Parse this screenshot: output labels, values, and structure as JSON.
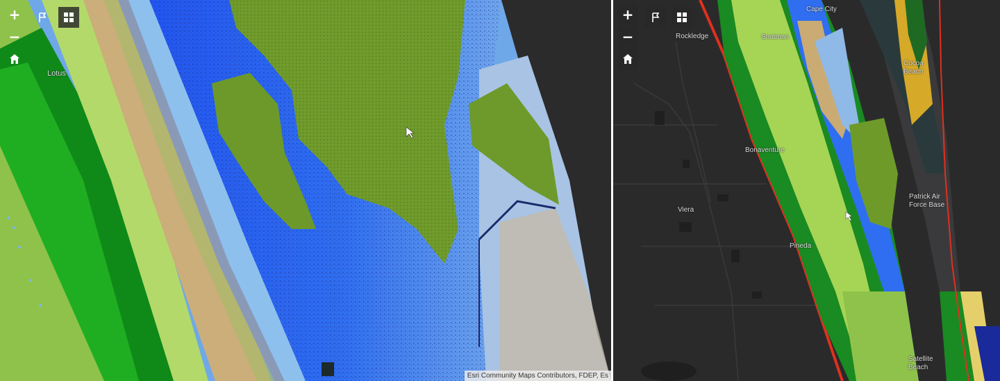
{
  "left_map": {
    "controls": {
      "zoom_in": "+",
      "zoom_out": "−",
      "home_icon": "home-icon",
      "pin_icon": "map-pin-icon",
      "grid_icon": "grid-icon"
    },
    "places": [
      "Lotus"
    ],
    "attribution": "Esri Community Maps Contributors, FDEP, Es"
  },
  "right_map": {
    "controls": {
      "zoom_in": "+",
      "zoom_out": "−",
      "home_icon": "home-icon",
      "pin_icon": "map-pin-icon",
      "grid_icon": "grid-icon"
    },
    "places": [
      {
        "id": "rockledge",
        "label": "Rockledge"
      },
      {
        "id": "cape-city",
        "label": "Cape City"
      },
      {
        "id": "snotman",
        "label": "Snotman"
      },
      {
        "id": "cocoa-beach",
        "label": "Cocoa Beach"
      },
      {
        "id": "bonaventure",
        "label": "Bonaventure"
      },
      {
        "id": "viera",
        "label": "Viera"
      },
      {
        "id": "patrick-afb",
        "label": "Patrick Air Force Base"
      },
      {
        "id": "pineda",
        "label": "Pineda"
      },
      {
        "id": "satellite-beach",
        "label": "Satellite Beach"
      }
    ]
  },
  "colors": {
    "deep_blue": "#1f4fe6",
    "light_blue": "#8fb9e6",
    "olive_green": "#6e9a2a",
    "bright_green": "#1fa81f",
    "lime": "#a6d455",
    "tan": "#c9ab73",
    "red_line": "#e0301e",
    "dark_base": "#2a2a2b"
  }
}
